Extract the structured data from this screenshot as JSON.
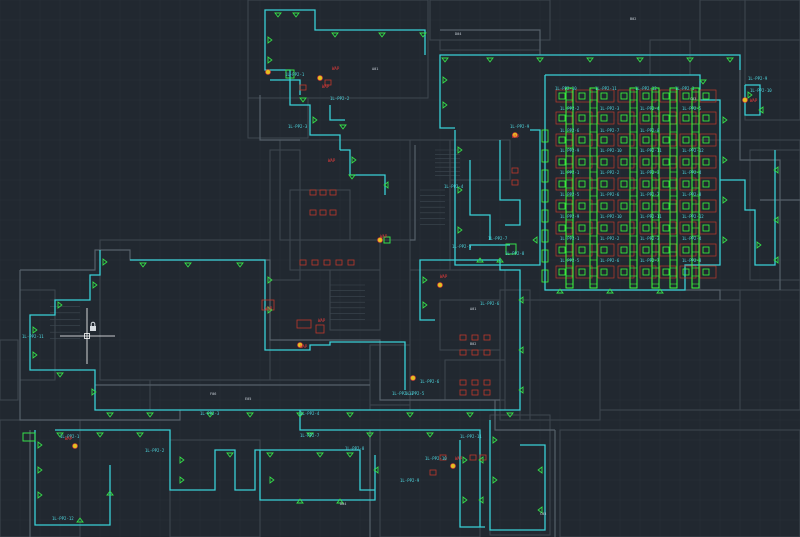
{
  "colors": {
    "background": "#212830",
    "grid": "#2a323b",
    "walls": "#56606a",
    "wall_light": "#3e4750",
    "cable": "#39d0d6",
    "outlet": "#35e04a",
    "desk_outlet": "#3bff3b",
    "furniture": "#c0392b",
    "label_red": "#e83a3a",
    "label_cyan": "#4fd8e0",
    "cursor": "#ffffff"
  },
  "icons": [
    "crosshair-cursor-icon",
    "lock-icon",
    "network-outlet-icon",
    "access-point-icon"
  ],
  "labels": {
    "cable_tags": [
      "1L-PP2-1",
      "1L-PP2-2",
      "1L-PP2-3",
      "1L-PP2-4",
      "1L-PP2-5",
      "1L-PP2-6",
      "1L-PP2-7",
      "1L-PP2-8",
      "1L-PP2-9",
      "1L-PP2-10",
      "1L-PP2-11",
      "1L-PP2-12"
    ],
    "red_notes": [
      "WAP",
      "WAP",
      "WAP",
      "WAP",
      "WAP",
      "WAP",
      "WAP",
      "WAP"
    ],
    "white_notes": [
      "A01",
      "B02",
      "C03",
      "D04",
      "E05",
      "F06"
    ]
  }
}
